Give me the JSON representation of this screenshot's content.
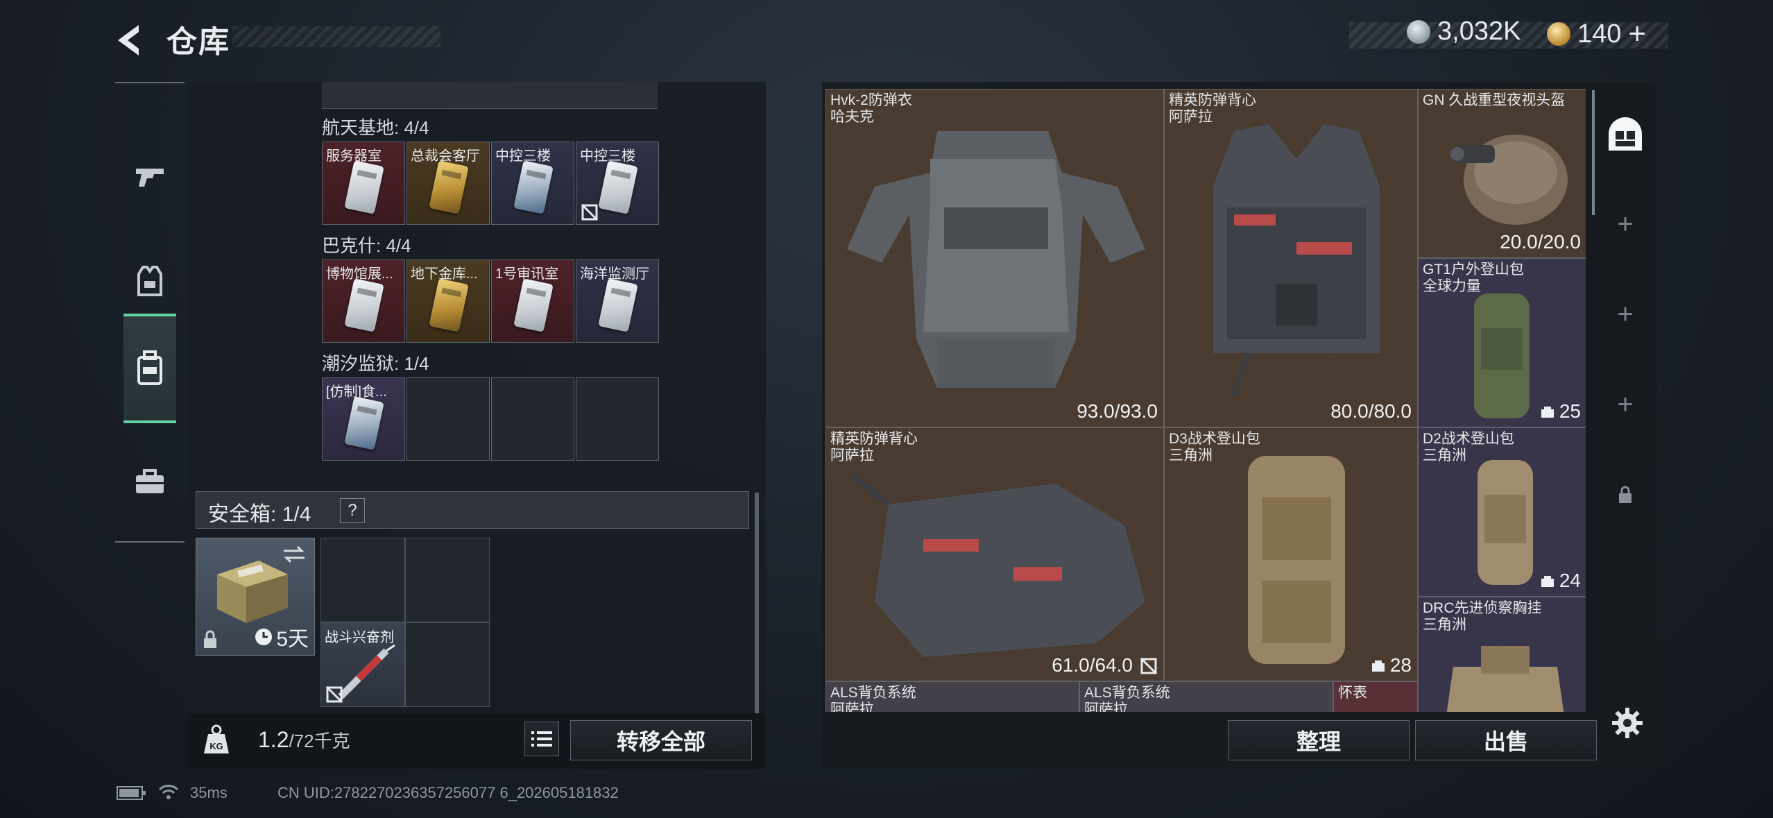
{
  "header": {
    "title": "仓库",
    "currency_silver": "3,032K",
    "currency_gold": "140",
    "plus": "+"
  },
  "keycards": {
    "sections": [
      {
        "label": "航天基地: 4/4",
        "cards": [
          {
            "name": "服务器室",
            "color": "red",
            "card": "white",
            "unavailable": false
          },
          {
            "name": "总裁会客厅",
            "color": "gold",
            "card": "goldc",
            "unavailable": false
          },
          {
            "name": "中控三楼",
            "color": "blue",
            "card": "bluec",
            "unavailable": false
          },
          {
            "name": "中控三楼",
            "color": "blue",
            "card": "white",
            "unavailable": true
          }
        ]
      },
      {
        "label": "巴克什: 4/4",
        "cards": [
          {
            "name": "博物馆展...",
            "color": "red",
            "card": "white",
            "unavailable": false
          },
          {
            "name": "地下金库...",
            "color": "gold",
            "card": "goldc",
            "unavailable": false
          },
          {
            "name": "1号审讯室",
            "color": "red",
            "card": "white",
            "unavailable": false
          },
          {
            "name": "海洋监测厅",
            "color": "blue",
            "card": "white",
            "unavailable": false
          }
        ]
      },
      {
        "label": "潮汐监狱: 1/4",
        "cards": [
          {
            "name": "[仿制]食...",
            "color": "purple",
            "card": "bluec",
            "unavailable": false
          },
          {
            "name": "",
            "color": "empty",
            "card": "",
            "unavailable": false
          },
          {
            "name": "",
            "color": "empty",
            "card": "",
            "unavailable": false
          },
          {
            "name": "",
            "color": "empty",
            "card": "",
            "unavailable": false
          }
        ]
      }
    ]
  },
  "safe": {
    "label": "安全箱: 1/4",
    "help": "?",
    "timer": "5天",
    "stim_name": "战斗兴奋剂"
  },
  "footer_left": {
    "weight_icon": "KG",
    "weight": "1.2",
    "weight_max": "/72千克",
    "transfer_all": "转移全部"
  },
  "items": [
    {
      "name": "Hvk-2防弹衣",
      "sub": "哈夫克",
      "value": "93.0/93.0"
    },
    {
      "name": "精英防弹背心",
      "sub": "阿萨拉",
      "value": "80.0/80.0"
    },
    {
      "name": "GN 久战重型夜视头盔",
      "sub": "",
      "value": "20.0/20.0"
    },
    {
      "name": "GT1户外登山包",
      "sub": "全球力量",
      "value": "25"
    },
    {
      "name": "精英防弹背心",
      "sub": "阿萨拉",
      "value": "61.0/64.0"
    },
    {
      "name": "D3战术登山包",
      "sub": "三角洲",
      "value": "28"
    },
    {
      "name": "D2战术登山包",
      "sub": "三角洲",
      "value": "24"
    },
    {
      "name": "DRC先进侦察胸挂",
      "sub": "三角洲",
      "value": ""
    },
    {
      "name": "ALS背负系统",
      "sub": "阿萨拉",
      "value": ""
    },
    {
      "name": "ALS背负系统",
      "sub": "阿萨拉",
      "value": ""
    },
    {
      "name": "怀表",
      "sub": "",
      "value": ""
    }
  ],
  "footer_right": {
    "sort": "整理",
    "sell": "出售"
  },
  "status": {
    "ping": "35ms",
    "uid": "CN UID:2782270236357256077 6_202605181832"
  },
  "colors": {
    "accent": "#5fd4a0",
    "bg": "#1a2028"
  }
}
